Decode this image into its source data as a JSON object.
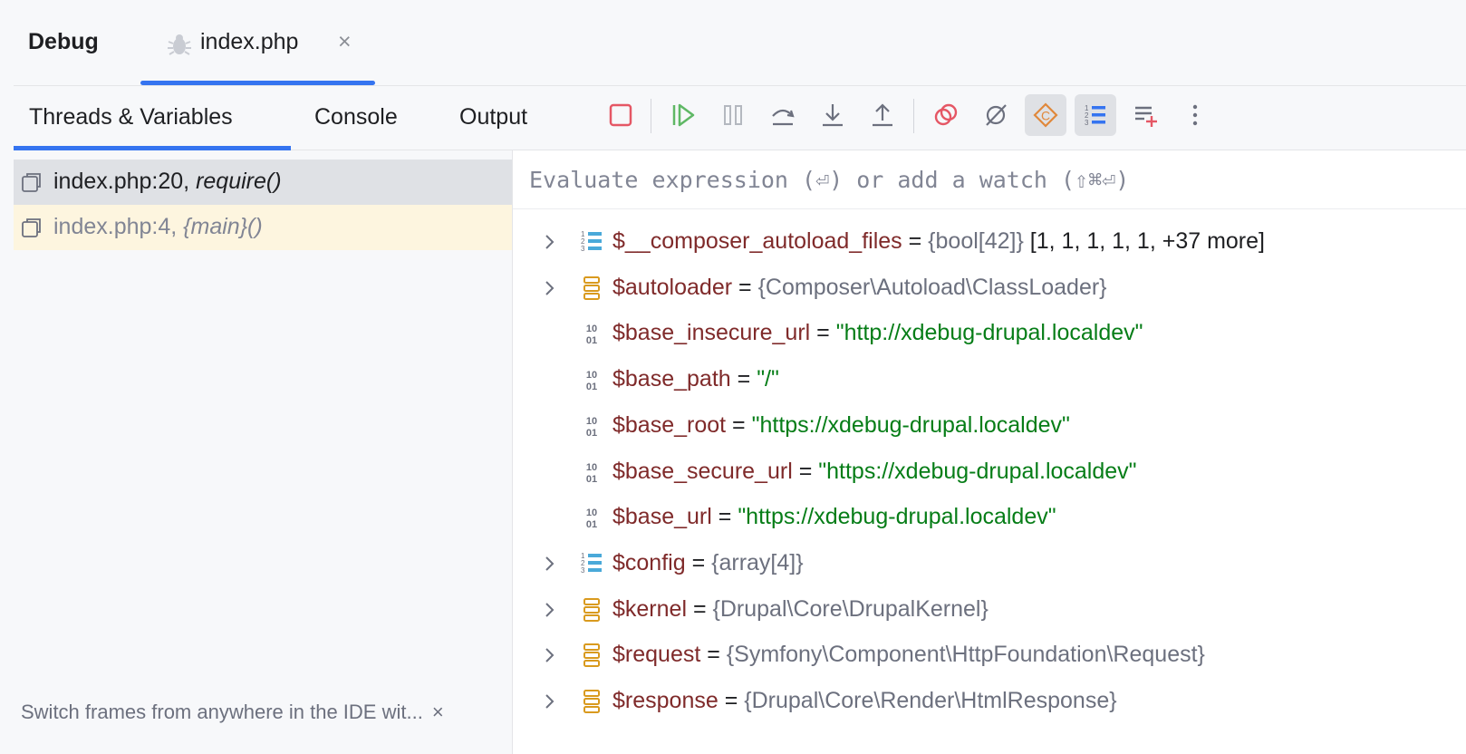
{
  "window": {
    "title": "Debug",
    "file_tab": "index.php",
    "close_glyph": "×"
  },
  "tabs": [
    {
      "label": "Threads & Variables",
      "active": true
    },
    {
      "label": "Console"
    },
    {
      "label": "Output"
    }
  ],
  "toolbar_icons": [
    "stop-icon",
    "resume-icon",
    "pause-icon",
    "step-over-icon",
    "step-into-icon",
    "step-out-icon",
    "view-breakpoints-icon",
    "mute-breakpoints-icon",
    "settings-icon",
    "show-values-icon",
    "add-watch-icon",
    "more-icon"
  ],
  "frames": [
    {
      "location": "index.php:20,",
      "func": "require()",
      "selected": true
    },
    {
      "location": "index.php:4,",
      "func": "{main}()",
      "selected": false
    }
  ],
  "hint": {
    "text": "Switch frames from anywhere in the IDE wit...",
    "close": "×"
  },
  "evaluate": {
    "placeholder": "Evaluate expression (⏎) or add a watch (⇧⌘⏎)"
  },
  "variables": [
    {
      "name": "$__composer_autoload_files",
      "type": "{bool[42]}",
      "value": "[1, 1, 1, 1, 1, +37 more]",
      "icon": "array-icon",
      "expandable": true
    },
    {
      "name": "$autoloader",
      "type": "{Composer\\Autoload\\ClassLoader}",
      "value": "",
      "icon": "object-icon",
      "expandable": true
    },
    {
      "name": "$base_insecure_url",
      "string": "\"http://xdebug-drupal.localdev\"",
      "icon": "primitive-icon",
      "expandable": false
    },
    {
      "name": "$base_path",
      "string": "\"/\"",
      "icon": "primitive-icon",
      "expandable": false
    },
    {
      "name": "$base_root",
      "string": "\"https://xdebug-drupal.localdev\"",
      "icon": "primitive-icon",
      "expandable": false
    },
    {
      "name": "$base_secure_url",
      "string": "\"https://xdebug-drupal.localdev\"",
      "icon": "primitive-icon",
      "expandable": false
    },
    {
      "name": "$base_url",
      "string": "\"https://xdebug-drupal.localdev\"",
      "icon": "primitive-icon",
      "expandable": false
    },
    {
      "name": "$config",
      "type": "{array[4]}",
      "value": "",
      "icon": "array-icon",
      "expandable": true
    },
    {
      "name": "$kernel",
      "type": "{Drupal\\Core\\DrupalKernel}",
      "value": "",
      "icon": "object-icon",
      "expandable": true
    },
    {
      "name": "$request",
      "type": "{Symfony\\Component\\HttpFoundation\\Request}",
      "value": "",
      "icon": "object-icon",
      "expandable": true
    },
    {
      "name": "$response",
      "type": "{Drupal\\Core\\Render\\HtmlResponse}",
      "value": "",
      "icon": "object-icon",
      "expandable": true
    }
  ],
  "colors": {
    "accent": "#3574f0",
    "var_name": "#7f2a2a",
    "string": "#067d17",
    "type": "#6c707e",
    "frame_highlight": "#fdf5df"
  }
}
